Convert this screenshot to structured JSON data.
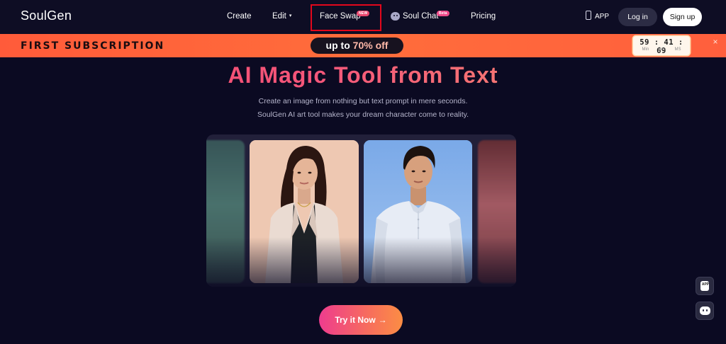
{
  "nav": {
    "logo": "SoulGen",
    "items": [
      {
        "label": "Create"
      },
      {
        "label": "Edit",
        "caret": "▾"
      },
      {
        "label": "Face Swap",
        "badge": "NEW"
      },
      {
        "label": "Soul Chat",
        "badge": "Beta"
      },
      {
        "label": "Pricing"
      }
    ],
    "app_label": "APP",
    "login_label": "Log in",
    "signup_label": "Sign up",
    "highlighted_item": "Face Swap",
    "highlight_color": "#e3071c"
  },
  "promo": {
    "label": "FIRST SUBSCRIPTION",
    "offer_prefix": "up to",
    "offer_value": "70% off",
    "timer": {
      "digits": "59 : 41 : 69",
      "min_label": "Min",
      "sec_label": "Sec",
      "ms_label": "MS"
    },
    "close": "×",
    "background": "#ff6d3b"
  },
  "hero": {
    "title": "AI Magic Tool from Text",
    "subtitle_line1": "Create an image from nothing but text prompt in mere seconds.",
    "subtitle_line2": "SoulGen AI art tool makes your dream character come to reality."
  },
  "cta": {
    "label": "Try it Now",
    "arrow": "→"
  },
  "floating": {
    "app_label": "APP"
  },
  "icons": [
    "chat-bubble-icon",
    "phone-icon",
    "caret-down-icon",
    "close-icon",
    "arrow-right-icon",
    "discord-icon"
  ]
}
